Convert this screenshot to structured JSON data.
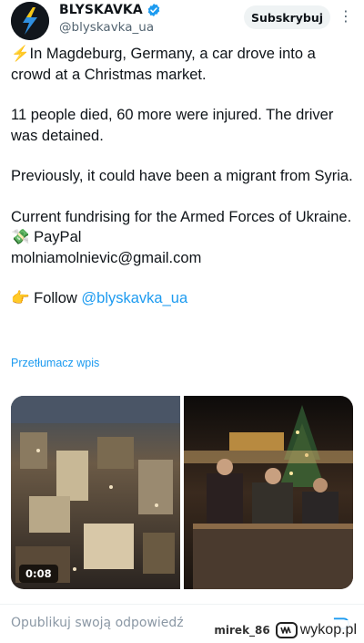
{
  "account": {
    "display_name": "BLYSKAVKA",
    "handle": "@blyskavka_ua",
    "subscribe_label": "Subskrybuj",
    "more_glyph": "⋮"
  },
  "post": {
    "p1": "⚡In Magdeburg, Germany, a car drove into a crowd at a Christmas market.",
    "p2": "11 people died, 60 more were injured. The driver was detained.",
    "p3": "Previously, it could have been a migrant from Syria.",
    "p4_line1": "Current fundrising for the Armed Forces of Ukraine.",
    "p4_line2": "💸 PayPal",
    "p4_line3": "molniamolnievic@gmail.com",
    "follow_prefix": "👉 Follow ",
    "follow_mention": "@blyskavka_ua"
  },
  "translate_label": "Przetłumacz wpis",
  "media": {
    "video_duration": "0:08"
  },
  "reply_hint": "Opublikuj swoją odpowiedź",
  "watermark": {
    "user": "mirek_86",
    "site": "wykop.pl"
  },
  "colors": {
    "accent": "#1d9bf0",
    "text": "#0f1419",
    "muted": "#536471"
  },
  "icons": [
    "lightning-avatar-icon",
    "verified-badge-icon",
    "more-options-icon",
    "reply-icon",
    "wykop-logo-icon"
  ]
}
